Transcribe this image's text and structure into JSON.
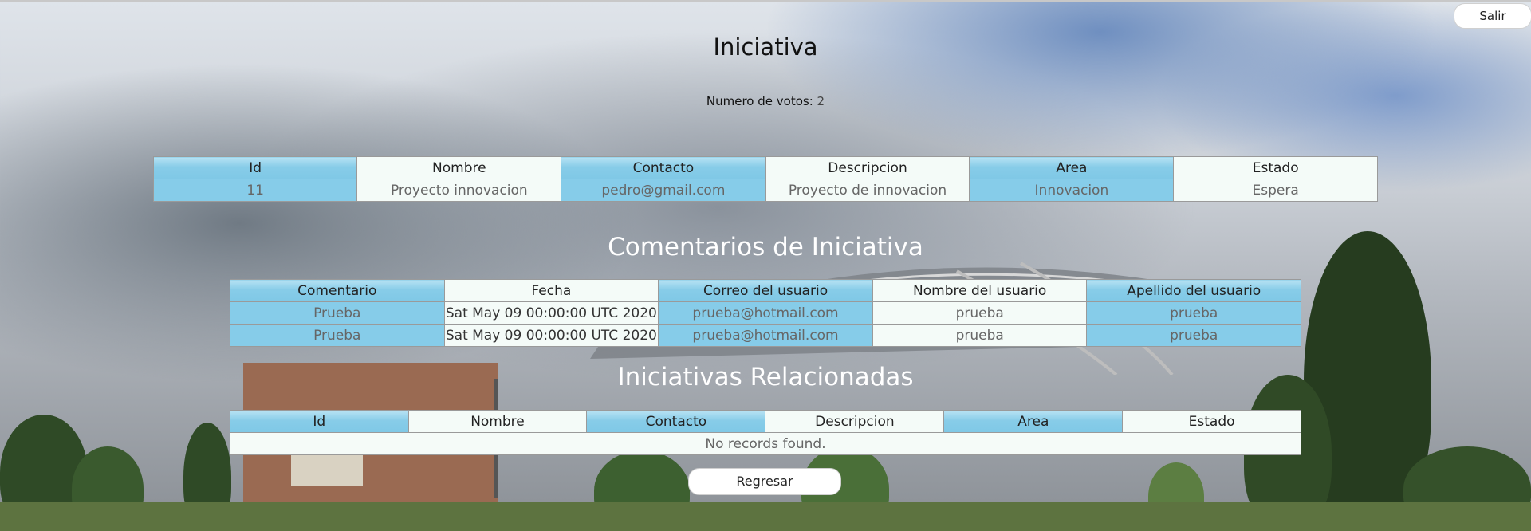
{
  "header": {
    "logout_label": "Salir"
  },
  "page": {
    "title": "Iniciativa",
    "votes_label": "Numero de votos:",
    "votes_value": "2"
  },
  "initiative_table": {
    "columns": [
      "Id",
      "Nombre",
      "Contacto",
      "Descripcion",
      "Area",
      "Estado"
    ],
    "row": [
      "11",
      "Proyecto innovacion",
      "pedro@gmail.com",
      "Proyecto de innovacion",
      "Innovacion",
      "Espera"
    ]
  },
  "comments": {
    "title": "Comentarios de Iniciativa",
    "columns": [
      "Comentario",
      "Fecha",
      "Correo del usuario",
      "Nombre del usuario",
      "Apellido del usuario"
    ],
    "rows": [
      [
        "Prueba",
        "Sat May 09 00:00:00 UTC 2020",
        "prueba@hotmail.com",
        "prueba",
        "prueba"
      ],
      [
        "Prueba",
        "Sat May 09 00:00:00 UTC 2020",
        "prueba@hotmail.com",
        "prueba",
        "prueba"
      ]
    ]
  },
  "related": {
    "title": "Iniciativas Relacionadas",
    "columns": [
      "Id",
      "Nombre",
      "Contacto",
      "Descripcion",
      "Area",
      "Estado"
    ],
    "empty_message": "No records found."
  },
  "footer": {
    "back_label": "Regresar"
  },
  "colors": {
    "header_blue": "#86cce9",
    "cell_light": "#f4fbf8"
  }
}
